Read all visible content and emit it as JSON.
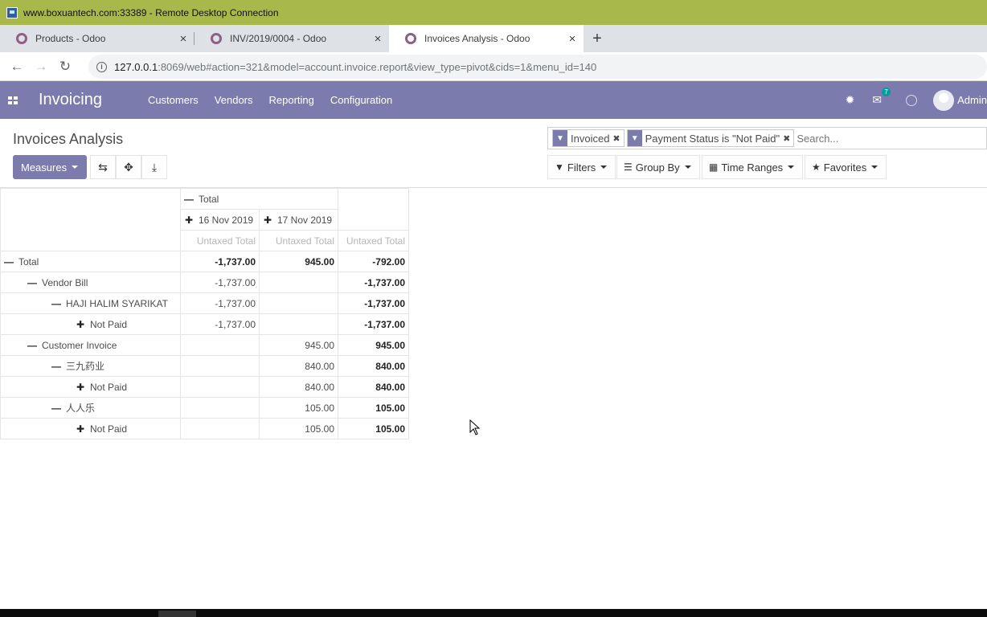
{
  "remote_desktop": {
    "title": "www.boxuantech.com:33389 - Remote Desktop Connection"
  },
  "browser": {
    "tabs": [
      {
        "label": "Products - Odoo",
        "close": "×"
      },
      {
        "label": "INV/2019/0004 - Odoo",
        "close": "×"
      },
      {
        "label": "Invoices Analysis - Odoo",
        "close": "×"
      }
    ],
    "new_tab": "+",
    "url_host": "127.0.0.1",
    "url_rest": ":8069/web#action=321&model=account.invoice.report&view_type=pivot&cids=1&menu_id=140"
  },
  "navbar": {
    "brand": "Invoicing",
    "menu": [
      "Customers",
      "Vendors",
      "Reporting",
      "Configuration"
    ],
    "chat_count": "7",
    "user": "Admin"
  },
  "control_panel": {
    "title": "Invoices Analysis",
    "measures_label": "Measures",
    "facets": [
      "Invoiced",
      "Payment Status is \"Not Paid\""
    ],
    "search_placeholder": "Search...",
    "filters_label": "Filters",
    "group_by_label": "Group By",
    "time_ranges_label": "Time Ranges",
    "favorites_label": "Favorites"
  },
  "pivot": {
    "col_total": "Total",
    "col_groups": [
      "16 Nov 2019",
      "17 Nov 2019"
    ],
    "measure": "Untaxed Total",
    "rows": [
      {
        "label": "Total",
        "c1": "-1,737.00",
        "c2": "945.00",
        "total": "-792.00"
      },
      {
        "label": "Vendor Bill",
        "c1": "-1,737.00",
        "c2": "",
        "total": "-1,737.00"
      },
      {
        "label": "HAJI HALIM SYARIKAT",
        "c1": "-1,737.00",
        "c2": "",
        "total": "-1,737.00"
      },
      {
        "label": "Not Paid",
        "c1": "-1,737.00",
        "c2": "",
        "total": "-1,737.00"
      },
      {
        "label": "Customer Invoice",
        "c1": "",
        "c2": "945.00",
        "total": "945.00"
      },
      {
        "label": "三九药业",
        "c1": "",
        "c2": "840.00",
        "total": "840.00"
      },
      {
        "label": "Not Paid",
        "c1": "",
        "c2": "840.00",
        "total": "840.00"
      },
      {
        "label": "人人乐",
        "c1": "",
        "c2": "105.00",
        "total": "105.00"
      },
      {
        "label": "Not Paid",
        "c1": "",
        "c2": "105.00",
        "total": "105.00"
      }
    ]
  },
  "colors": {
    "odoo_purple": "#7c7bad",
    "rd_bar": "#a8b84a",
    "badge": "#00a09d"
  }
}
